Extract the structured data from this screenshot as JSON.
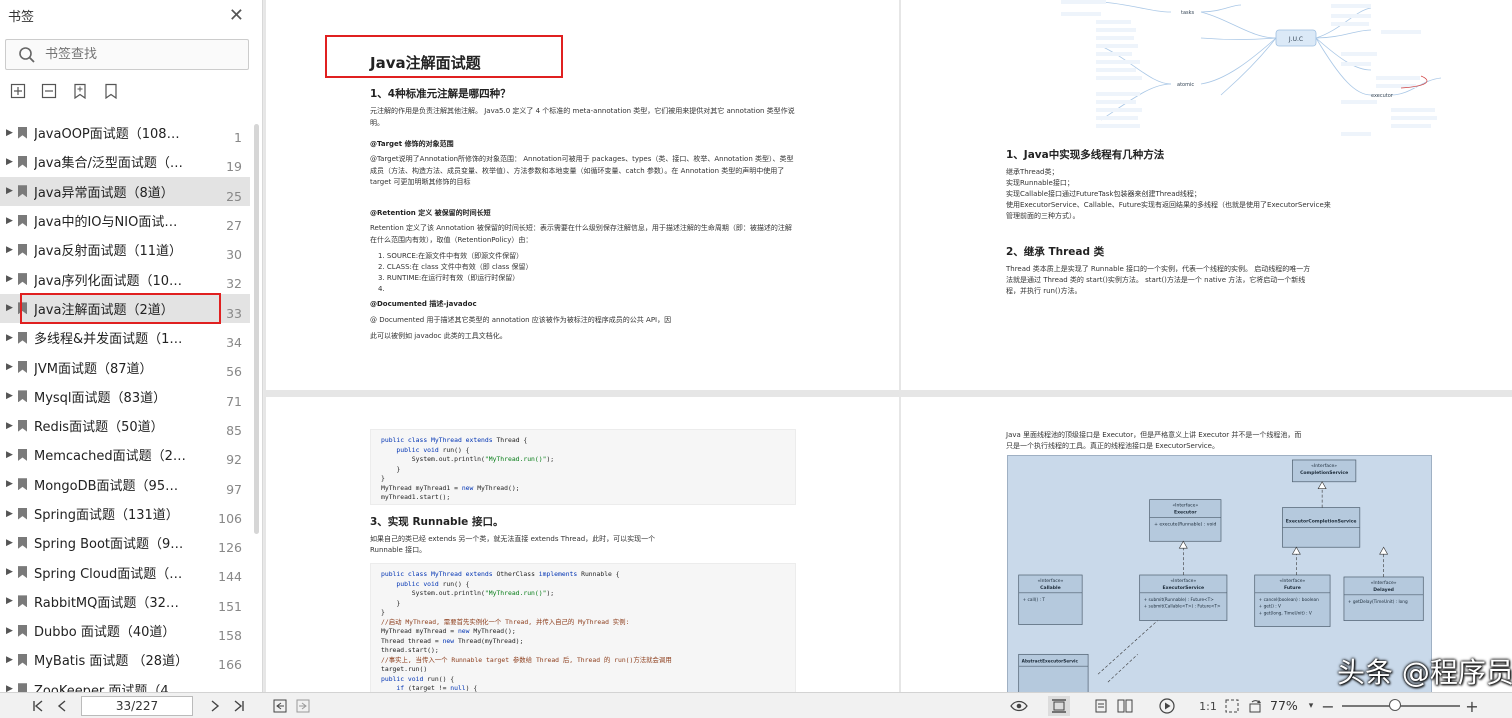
{
  "sidebar": {
    "title": "书签",
    "search_placeholder": "书签查找",
    "items": [
      {
        "label": "JavaOOP面试题（108道）",
        "page": "1"
      },
      {
        "label": "Java集合/泛型面试题（2...",
        "page": "19"
      },
      {
        "label": "Java异常面试题（8道）",
        "page": "25"
      },
      {
        "label": "Java中的IO与NIO面试题...",
        "page": "27"
      },
      {
        "label": "Java反射面试题（11道）",
        "page": "30"
      },
      {
        "label": "Java序列化面试题（10道）",
        "page": "32"
      },
      {
        "label": "Java注解面试题（2道）",
        "page": "33"
      },
      {
        "label": "多线程&并发面试题（10...",
        "page": "34"
      },
      {
        "label": "JVM面试题（87道）",
        "page": "56"
      },
      {
        "label": "Mysql面试题（83道）",
        "page": "71"
      },
      {
        "label": "Redis面试题（50道）",
        "page": "85"
      },
      {
        "label": "Memcached面试题（24...",
        "page": "92"
      },
      {
        "label": "MongoDB面试题（95道）",
        "page": "97"
      },
      {
        "label": "Spring面试题（131道）",
        "page": "106"
      },
      {
        "label": "Spring Boot面试题（92...",
        "page": "126"
      },
      {
        "label": "Spring Cloud面试题（35...",
        "page": "144"
      },
      {
        "label": "RabbitMQ面试题（32道）",
        "page": "151"
      },
      {
        "label": "Dubbo 面试题（40道）",
        "page": "158"
      },
      {
        "label": "MyBatis 面试题 （28道）",
        "page": "166"
      },
      {
        "label": "ZooKeeper 面试题（49...",
        "page": ""
      }
    ]
  },
  "page1": {
    "title": "Java注解面试题",
    "q1": "1、4种标准元注解是哪四种？",
    "intro": "元注解的作用是负责注解其他注解。 Java5.0 定义了 4 个标准的 meta-annotation 类型，它们被用来提供对其它 annotation 类型作说明。",
    "target_h": "@Target 修饰的对象范围",
    "target_body": "@Target说明了Annotation所修饰的对象范围： Annotation可被用于 packages、types（类、接口、枚举、Annotation 类型）、类型成员（方法、构造方法、成员变量、枚举值）、方法参数和本地变量（如循环变量、catch 参数）。在 Annotation 类型的声明中使用了 target 可更加明晰其修饰的目标",
    "retention_h": "@Retention 定义 被保留的时间长短",
    "retention_body": "Retention 定义了该 Annotation 被保留的时间长短：表示需要在什么级别保存注解信息，用于描述注解的生命周期（即：被描述的注解在什么范围内有效），取值（RetentionPolicy）由：",
    "list": [
      "1. SOURCE:在源文件中有效（即源文件保留）",
      "2. CLASS:在 class 文件中有效（即 class 保留）",
      "3. RUNTIME:在运行时有效（即运行时保留）",
      "4."
    ],
    "documented_h": "@Documented 描述-javadoc",
    "documented_body": "@ Documented 用于描述其它类型的 annotation 应该被作为被标注的程序成员的公共 API，因",
    "documented_body2": "此可以被例如 javadoc 此类的工具文档化。"
  },
  "page2": {
    "h1": "1、Java中实现多线程有几种方法",
    "l1": "继承Thread类；",
    "l2": "实现Runnable接口；",
    "l3": "实现Callable接口通过FutureTask包装器来创建Thread线程；",
    "l4": "使用ExecutorService、Callable、Future实现有返回结果的多线程（也就是使用了ExecutorService来",
    "l5": "管理前面的三种方式）。",
    "h2": "2、继承 Thread 类",
    "p1": "Thread 类本质上是实现了 Runnable 接口的一个实例，代表一个线程的实例。 启动线程的唯一方",
    "p2": "法就是通过 Thread 类的 start()实例方法。 start()方法是一个 native 方法，它将启动一个新线",
    "p3": "程，并执行 run()方法。",
    "mm_center": "J.U.C",
    "mm_left1": "tasks",
    "mm_left2": "atomic",
    "mm_right": "executor"
  },
  "page3": {
    "h3": "3、实现 Runnable 接口。",
    "p1": "如果自己的类已经 extends 另一个类，就无法直接 extends Thread，此时，可以实现一个",
    "p2": "Runnable 接口。"
  },
  "page4": {
    "p1": "Java 里面线程池的顶级接口是 Executor，但是严格意义上讲 Executor 并不是一个线程池，而",
    "p2": "只是一个执行线程的工具。真正的线程池接口是 ExecutorService。",
    "uml": {
      "stereo": "«Interface»",
      "completion_service": "CompletionService",
      "executor": "Executor",
      "executor_m": "+ execute(Runnable) : void",
      "executor_completion": "ExecutorCompletionService",
      "callable": "Callable",
      "callable_m": "+ call() : T",
      "executor_service": "ExecutorService",
      "es_m1": "+ submit(Runnable) : Future<T>",
      "es_m2": "+ submit(Callable<T>) : Future<T>",
      "future": "Future",
      "f_m1": "+ cancel(boolean) : boolean",
      "f_m2": "+ get() : V",
      "f_m3": "+ get(long, TimeUnit) : V",
      "delayed": "Delayed",
      "d_m1": "+ getDelay(TimeUnit) : long",
      "abstract_es": "AbstractExecutorServic"
    }
  },
  "watermark": "头条 @程序员高级码农II",
  "bottombar": {
    "page_display": "33/227",
    "zoom": "77%"
  }
}
